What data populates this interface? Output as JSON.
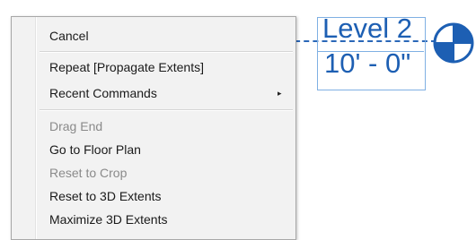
{
  "level_annotation": {
    "name": "Level 2",
    "elevation": "10' - 0\"",
    "color": "#1d5fb3"
  },
  "context_menu": {
    "items": [
      {
        "label": "Cancel",
        "enabled": true
      },
      {
        "label": "Repeat [Propagate Extents]",
        "enabled": true
      },
      {
        "label": "Recent Commands",
        "enabled": true,
        "submenu": true,
        "submenu_glyph": "▸"
      },
      {
        "label": "Drag End",
        "enabled": false
      },
      {
        "label": "Go to Floor Plan",
        "enabled": true
      },
      {
        "label": "Reset to Crop",
        "enabled": false
      },
      {
        "label": "Reset to 3D Extents",
        "enabled": true
      },
      {
        "label": "Maximize 3D Extents",
        "enabled": true
      }
    ]
  }
}
